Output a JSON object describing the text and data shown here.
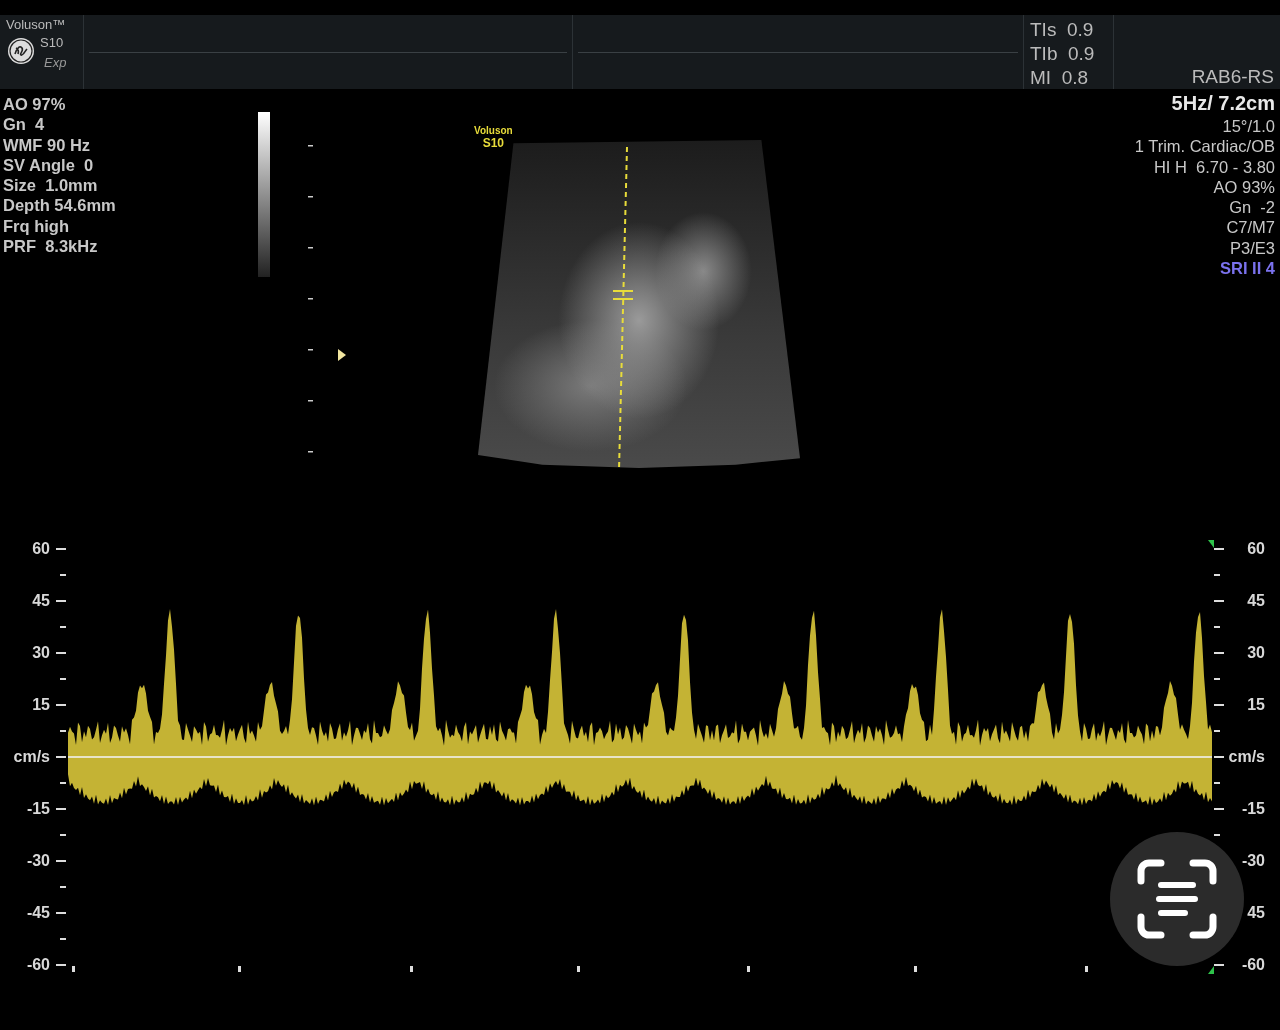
{
  "header": {
    "brand": "Voluson™",
    "model": "S10",
    "edition": "Exp",
    "safety_indices": [
      {
        "label": "TIs",
        "value": "0.9"
      },
      {
        "label": "TIb",
        "value": "0.9"
      },
      {
        "label": "MI",
        "value": "0.8"
      }
    ],
    "probe": "RAB6-RS"
  },
  "left_params": [
    "AO 97%",
    "Gn  4",
    "WMF 90 Hz",
    "SV Angle  0",
    "Size  1.0mm",
    "Depth 54.6mm",
    "Frq high",
    "PRF  8.3kHz"
  ],
  "right_params": [
    {
      "text": "5Hz/ 7.2cm",
      "kind": "headline"
    },
    {
      "text": "15°/1.0",
      "kind": "normal"
    },
    {
      "text": "1 Trim. Cardiac/OB",
      "kind": "normal"
    },
    {
      "text": "HI H  6.70 - 3.80",
      "kind": "normal"
    },
    {
      "text": "AO 93%",
      "kind": "normal"
    },
    {
      "text": "Gn  -2",
      "kind": "normal"
    },
    {
      "text": "C7/M7",
      "kind": "normal"
    },
    {
      "text": "P3/E3",
      "kind": "normal"
    },
    {
      "text": "SRI II 4",
      "kind": "highlight"
    }
  ],
  "image_label": {
    "brand": "Voluson",
    "model": "S10"
  },
  "spectrum": {
    "left_scale": [
      "60",
      "45",
      "30",
      "15",
      "cm/s",
      "-15",
      "-30",
      "-45",
      "-60"
    ],
    "right_scale": [
      "60",
      "45",
      "30",
      "15",
      "cm/s",
      "-15",
      "-30",
      "45",
      "-60"
    ]
  }
}
